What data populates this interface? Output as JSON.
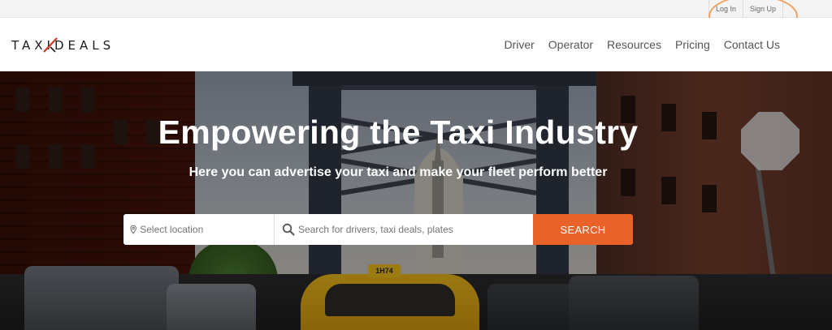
{
  "topbar": {
    "login_label": "Log In",
    "signup_label": "Sign Up"
  },
  "brand": {
    "name": "TAXIDEALS",
    "accent": "#c0392b"
  },
  "nav": {
    "items": [
      "Driver",
      "Operator",
      "Resources",
      "Pricing",
      "Contact Us"
    ]
  },
  "hero": {
    "title": "Empowering the Taxi Industry",
    "subtitle": "Here you can advertise your taxi and make your fleet perform better",
    "roof_sign": "1H74"
  },
  "search": {
    "location_placeholder": "Select location",
    "query_placeholder": "Search for drivers, taxi deals, plates",
    "button_label": "SEARCH",
    "button_color": "#e8622a",
    "location_icon": "map-pin-icon",
    "search_icon": "magnifier-icon"
  }
}
